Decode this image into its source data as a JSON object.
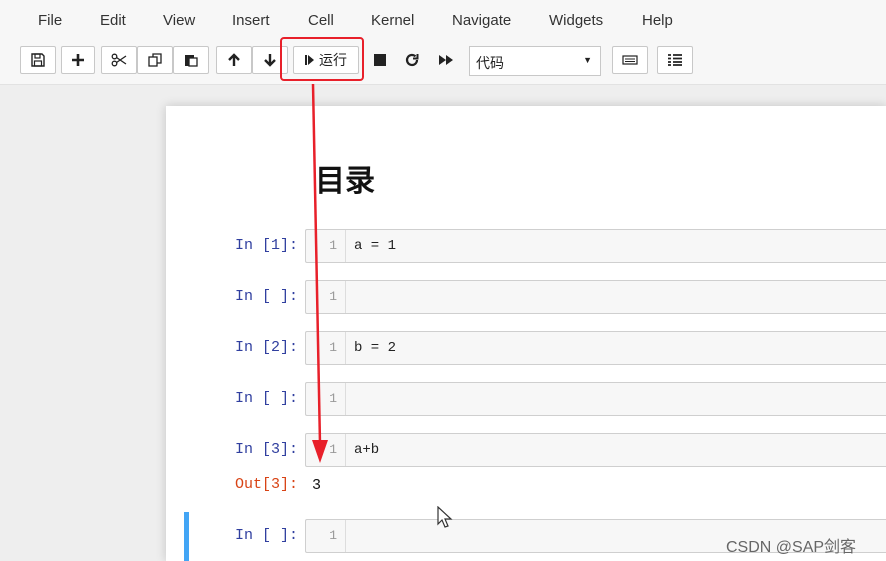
{
  "menubar": {
    "items": [
      "File",
      "Edit",
      "View",
      "Insert",
      "Cell",
      "Kernel",
      "Navigate",
      "Widgets",
      "Help"
    ]
  },
  "toolbar": {
    "run_label": "运行",
    "cell_type": "代码",
    "icons": [
      "save-icon",
      "plus-icon",
      "scissors-icon",
      "copy-icon",
      "paste-icon",
      "arrow-up-icon",
      "arrow-down-icon",
      "step-icon",
      "stop-icon",
      "restart-icon",
      "fast-forward-icon",
      "keyboard-icon",
      "list-icon"
    ]
  },
  "annotation": {
    "color": "#e8202a"
  },
  "notebook": {
    "heading": "目录",
    "cells": [
      {
        "prompt": "In [1]:",
        "line": "1",
        "code": "a = 1"
      },
      {
        "prompt": "In [ ]:",
        "line": "1",
        "code": ""
      },
      {
        "prompt": "In [2]:",
        "line": "1",
        "code": "b = 2"
      },
      {
        "prompt": "In [ ]:",
        "line": "1",
        "code": ""
      },
      {
        "prompt": "In [3]:",
        "line": "1",
        "code": "a+b"
      },
      {
        "prompt": "In [ ]:",
        "line": "1",
        "code": ""
      }
    ],
    "output": {
      "prompt": "Out[3]:",
      "value": "3"
    }
  },
  "watermark": "CSDN @SAP剑客"
}
